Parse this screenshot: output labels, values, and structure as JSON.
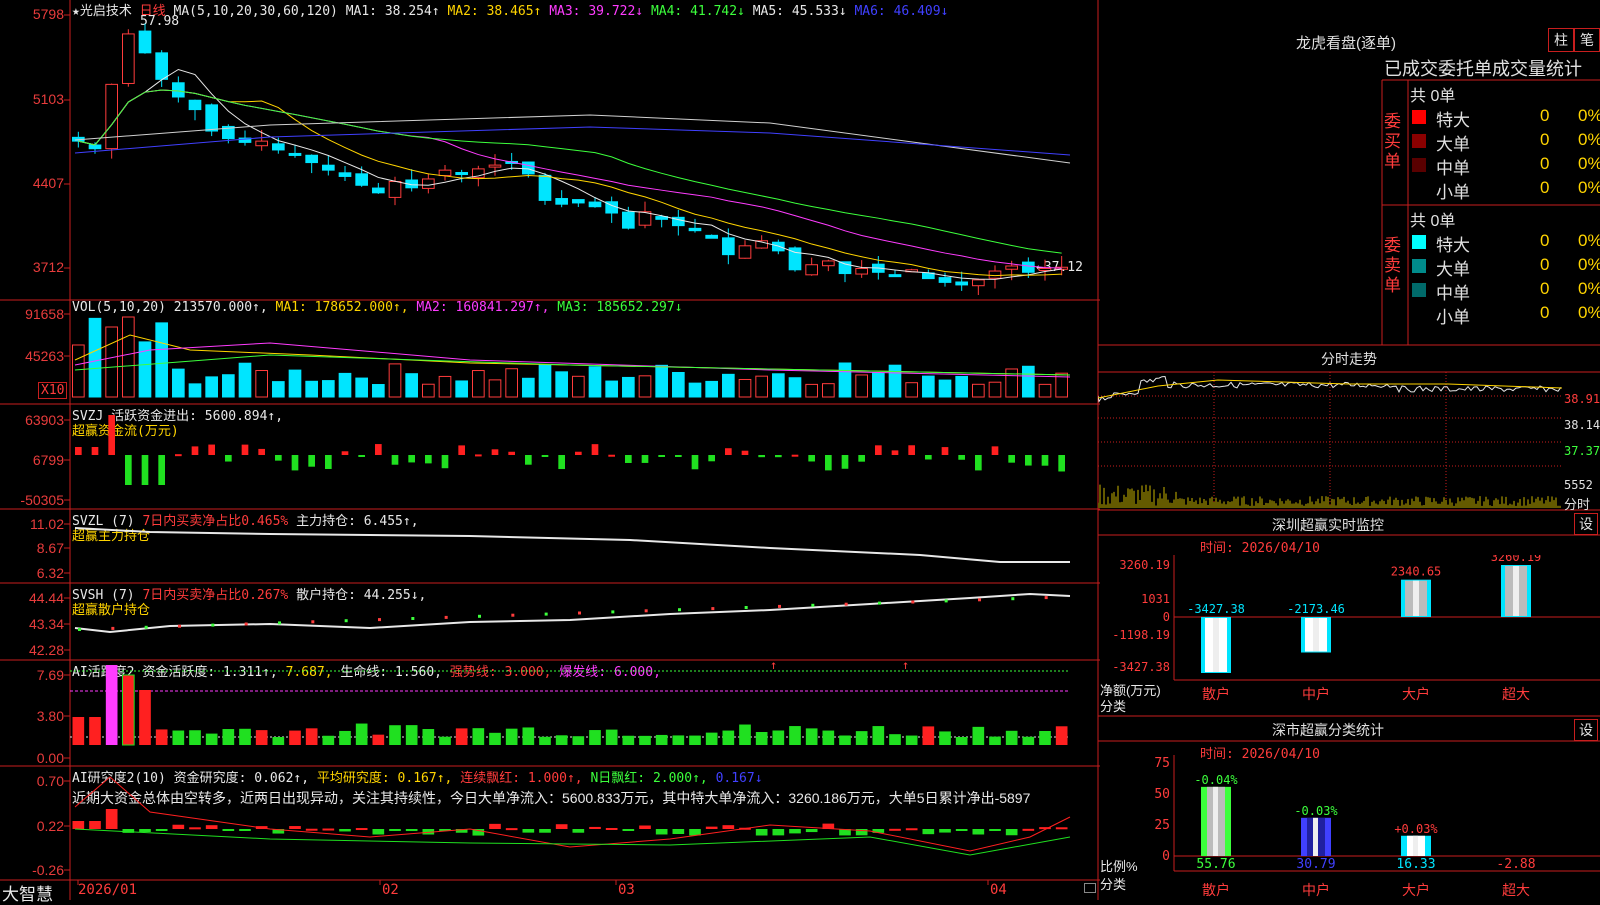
{
  "main": {
    "title": "★光启技术",
    "period": "日线",
    "ma_header": "MA(5,10,20,30,60,120)",
    "ma": [
      {
        "label": "MA1: 38.254↑",
        "color": "#e8e8e8"
      },
      {
        "label": "MA2: 38.465↑",
        "color": "#ffd400"
      },
      {
        "label": "MA3: 39.722↓",
        "color": "#ff3cff"
      },
      {
        "label": "MA4: 41.742↓",
        "color": "#3cff3c"
      },
      {
        "label": "MA5: 45.533↓",
        "color": "#e8e8e8"
      },
      {
        "label": "MA6: 46.409↓",
        "color": "#4040ff"
      }
    ],
    "y_labels": [
      "5798",
      "5103",
      "4407",
      "3712"
    ],
    "high_mark": "57.98",
    "low_mark": "←37.12"
  },
  "vol": {
    "header": "VOL(5,10,20)",
    "value": "213570.000↑,",
    "ma1": "MA1: 178652.000↑,",
    "ma2": "MA2: 160841.297↑,",
    "ma3": "MA3: 185652.297↓",
    "y_labels": [
      "91658",
      "45263"
    ],
    "unit": "X10"
  },
  "svzj": {
    "header": "SVZJ  活跃资金进出: 5600.894↑,",
    "subtitle": "超赢资金流(万元)",
    "y_labels": [
      "63903",
      "6799",
      "-50305"
    ]
  },
  "svzl": {
    "header_a": "SVZL (7)",
    "header_b": "7日内买卖净占比0.465%",
    "header_c": "主力持仓: 6.455↑,",
    "subtitle": "超赢主力持仓",
    "y_labels": [
      "11.02",
      "8.67",
      "6.32"
    ]
  },
  "svsh": {
    "header_a": "SVSH (7)",
    "header_b": "7日内买卖净占比0.267%",
    "header_c": "散户持仓: 44.255↓,",
    "subtitle": "超赢散户持仓",
    "y_labels": [
      "44.44",
      "43.34",
      "42.28"
    ]
  },
  "ai1": {
    "header_a": "AI活跃度2",
    "header_b": "资金活跃度: 1.311↑,",
    "header_c": "7.687,",
    "header_d": "生命线: 1.560,",
    "header_e": "强势线: 3.000,",
    "header_f": "爆发线: 6.000,",
    "y_labels": [
      "7.69",
      "3.80",
      "0.00"
    ]
  },
  "ai2": {
    "header_a": "AI研究度2(10)",
    "header_b": "资金研究度: 0.062↑,",
    "header_c": "平均研究度: 0.167↑,",
    "header_d": "连续飘红: 1.000↑,",
    "header_e": "N日飘红: 2.000↑,",
    "header_f": "0.167↓",
    "summary": "近期大资金总体由空转多，近两日出现异动，关注其持续性，今日大单净流入：5600.833万元，其中特大单净流入：3260.186万元，大单5日累计净出-5897",
    "y_labels": [
      "0.70",
      "0.22",
      "-0.26"
    ]
  },
  "xaxis": {
    "labels": [
      "2026/01",
      "02",
      "03",
      "04"
    ],
    "brand": "大智慧"
  },
  "right": {
    "title": "龙虎看盘(逐单)",
    "btn_bar": "柱",
    "btn_pen": "笔",
    "heading": "已成交委托单成交量统计",
    "buy": {
      "side_label": "委买单",
      "total": "共 0单",
      "rows": [
        {
          "name": "特大",
          "count": "0",
          "pct": "0%",
          "color": "#ff0000"
        },
        {
          "name": "大单",
          "count": "0",
          "pct": "0%",
          "color": "#8b0000"
        },
        {
          "name": "中单",
          "count": "0",
          "pct": "0%",
          "color": "#5a0000"
        },
        {
          "name": "小单",
          "count": "0",
          "pct": "0%",
          "color": ""
        }
      ]
    },
    "sell": {
      "side_label": "委卖单",
      "total": "共 0单",
      "rows": [
        {
          "name": "特大",
          "count": "0",
          "pct": "0%",
          "color": "#00ffff"
        },
        {
          "name": "大单",
          "count": "0",
          "pct": "0%",
          "color": "#008b8b"
        },
        {
          "name": "中单",
          "count": "0",
          "pct": "0%",
          "color": "#006a6a"
        },
        {
          "name": "小单",
          "count": "0",
          "pct": "0%",
          "color": ""
        }
      ]
    },
    "intraday": {
      "title": "分时走势",
      "y_labels": [
        "38.91",
        "38.14",
        "37.37",
        "5552"
      ],
      "x_label": "分时"
    },
    "monitor": {
      "title": "深圳超赢实时监控",
      "btn": "设",
      "time": "时间: 2026/04/10",
      "y_labels": [
        "3260.19",
        "1031",
        "0",
        "-1198.19",
        "-3427.38"
      ],
      "y_title": "净额(万元)",
      "x_title": "分类",
      "categories": [
        "散户",
        "中户",
        "大户",
        "超大"
      ],
      "values": [
        -3427.38,
        -2173.46,
        2340.65,
        3260.19
      ],
      "value_labels": [
        "-3427.38",
        "-2173.46",
        "2340.65",
        "3260.19"
      ]
    },
    "classify": {
      "title": "深市超赢分类统计",
      "btn": "设",
      "time": "时间: 2026/04/10",
      "y_labels": [
        "75",
        "50",
        "25",
        "0"
      ],
      "y_title": "比例%",
      "x_title": "分类",
      "categories": [
        "散户",
        "中户",
        "大户",
        "超大"
      ],
      "values": [
        55.76,
        30.79,
        16.33,
        -2.88
      ],
      "value_labels": [
        "55.76",
        "30.79",
        "16.33",
        "-2.88"
      ],
      "change_labels": [
        "-0.04%",
        "-0.03%",
        "+0.03%",
        ""
      ]
    }
  }
}
